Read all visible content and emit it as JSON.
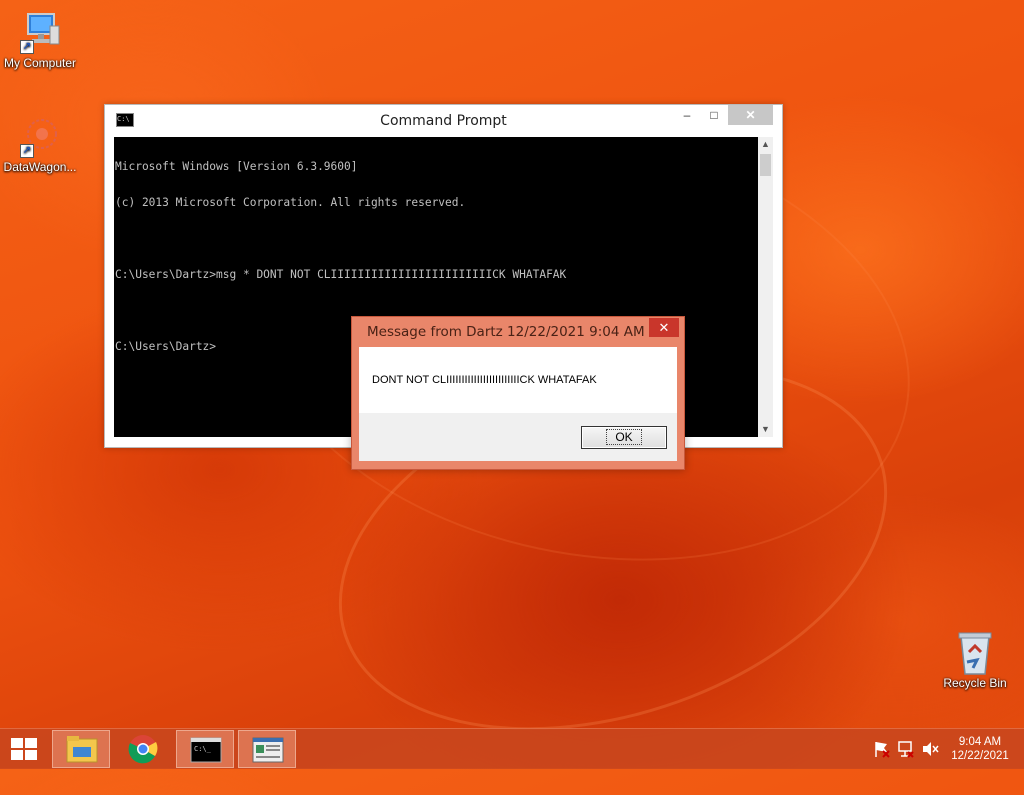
{
  "desktop": {
    "icons": [
      {
        "label": "My Computer",
        "icon": "computer-icon"
      },
      {
        "label": "DataWagon...",
        "icon": "datawagon-icon"
      },
      {
        "label": "Recycle Bin",
        "icon": "recycle-bin-icon"
      }
    ]
  },
  "cmd_window": {
    "title": "Command Prompt",
    "minimize_glyph": "–",
    "maximize_glyph": "□",
    "close_glyph": "✕",
    "lines": [
      "Microsoft Windows [Version 6.3.9600]",
      "(c) 2013 Microsoft Corporation. All rights reserved.",
      "",
      "C:\\Users\\Dartz>msg * DONT NOT CLIIIIIIIIIIIIIIIIIIIIIIIICK WHATAFAK",
      "",
      "C:\\Users\\Dartz>"
    ]
  },
  "message_box": {
    "title": "Message from Dartz 12/22/2021 9:04 AM",
    "close_glyph": "✕",
    "text": "DONT NOT CLIIIIIIIIIIIIIIIIIIIIIIIICK WHATAFAK",
    "ok_label": "OK"
  },
  "taskbar": {
    "items": [
      {
        "name": "file-explorer",
        "icon": "folder-icon"
      },
      {
        "name": "chrome",
        "icon": "chrome-icon"
      },
      {
        "name": "command-prompt",
        "icon": "cmd-icon"
      },
      {
        "name": "message-window",
        "icon": "window-icon"
      }
    ],
    "clock_time": "9:04 AM",
    "clock_date": "12/22/2021"
  },
  "colors": {
    "accent": "#e9866a",
    "desktop": "#ee520f",
    "close_red": "#c9362b"
  }
}
